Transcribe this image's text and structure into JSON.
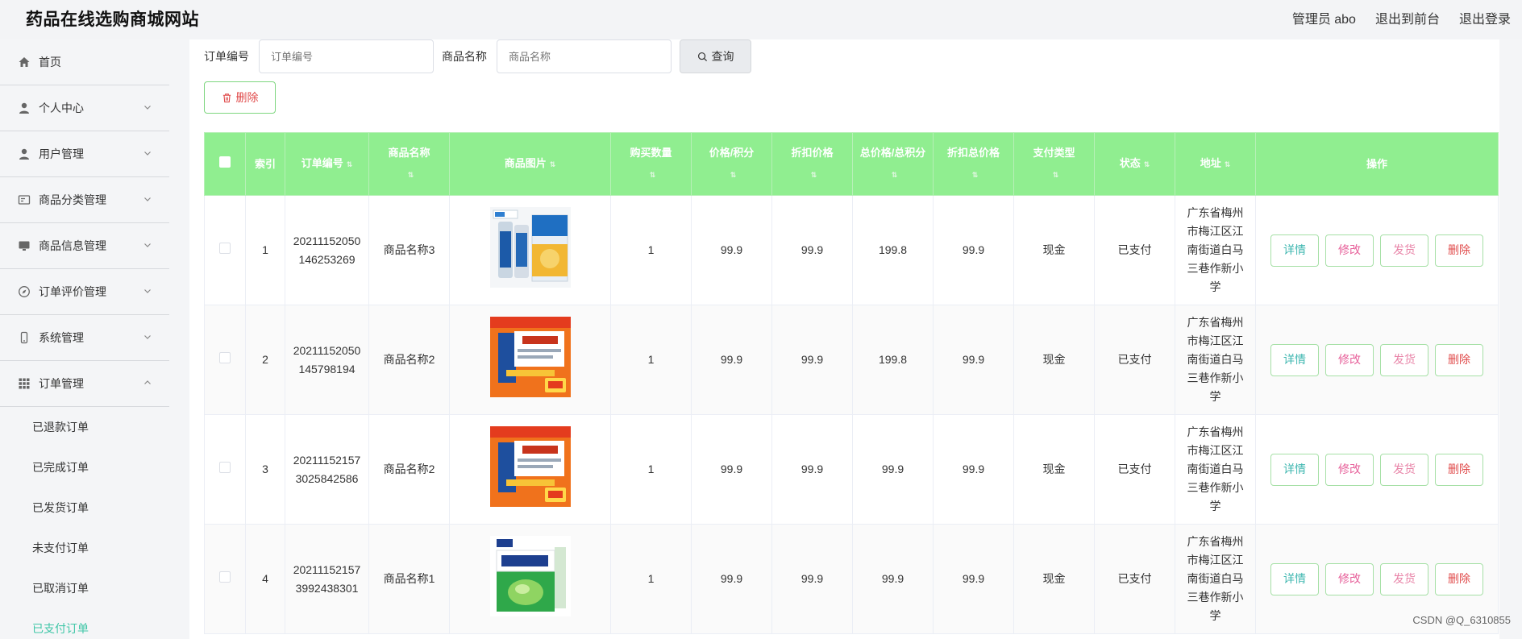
{
  "app": {
    "title": "药品在线选购商城网站",
    "user_label": "管理员 abo",
    "back_to_front": "退出到前台",
    "logout": "退出登录"
  },
  "sidebar": {
    "items": [
      {
        "label": "首页",
        "icon": "home-icon"
      },
      {
        "label": "个人中心",
        "icon": "user-icon"
      },
      {
        "label": "用户管理",
        "icon": "user-icon"
      },
      {
        "label": "商品分类管理",
        "icon": "category-icon"
      },
      {
        "label": "商品信息管理",
        "icon": "monitor-icon"
      },
      {
        "label": "订单评价管理",
        "icon": "compass-icon"
      },
      {
        "label": "系统管理",
        "icon": "phone-icon"
      },
      {
        "label": "订单管理",
        "icon": "grid-icon"
      }
    ],
    "sub_items": [
      {
        "label": "已退款订单"
      },
      {
        "label": "已完成订单"
      },
      {
        "label": "已发货订单"
      },
      {
        "label": "未支付订单"
      },
      {
        "label": "已取消订单"
      },
      {
        "label": "已支付订单"
      }
    ]
  },
  "filters": {
    "order_no_label": "订单编号",
    "order_no_placeholder": "订单编号",
    "product_name_label": "商品名称",
    "product_name_placeholder": "商品名称",
    "search_label": "查询"
  },
  "toolbar": {
    "delete_label": "删除"
  },
  "table": {
    "columns": [
      "索引",
      "订单编号",
      "商品名称",
      "商品图片",
      "购买数量",
      "价格/积分",
      "折扣价格",
      "总价格/总积分",
      "折扣总价格",
      "支付类型",
      "状态",
      "地址",
      "操作"
    ],
    "rows": [
      {
        "index": "1",
        "order_no": "20211152050146253269",
        "name": "商品名称3",
        "qty": "1",
        "price": "99.9",
        "discount_price": "99.9",
        "total": "199.8",
        "discount_total": "99.9",
        "pay_type": "现金",
        "status": "已支付",
        "address": "广东省梅州市梅江区江南街道白马三巷作新小学",
        "image": "blue-tubes"
      },
      {
        "index": "2",
        "order_no": "20211152050145798194",
        "name": "商品名称2",
        "qty": "1",
        "price": "99.9",
        "discount_price": "99.9",
        "total": "199.8",
        "discount_total": "99.9",
        "pay_type": "现金",
        "status": "已支付",
        "address": "广东省梅州市梅江区江南街道白马三巷作新小学",
        "image": "orange-box"
      },
      {
        "index": "3",
        "order_no": "202111521573025842586",
        "name": "商品名称2",
        "qty": "1",
        "price": "99.9",
        "discount_price": "99.9",
        "total": "99.9",
        "discount_total": "99.9",
        "pay_type": "现金",
        "status": "已支付",
        "address": "广东省梅州市梅江区江南街道白马三巷作新小学",
        "image": "orange-box"
      },
      {
        "index": "4",
        "order_no": "202111521573992438301",
        "name": "商品名称1",
        "qty": "1",
        "price": "99.9",
        "discount_price": "99.9",
        "total": "99.9",
        "discount_total": "99.9",
        "pay_type": "现金",
        "status": "已支付",
        "address": "广东省梅州市梅江区江南街道白马三巷作新小学",
        "image": "green-box"
      }
    ],
    "op_labels": {
      "detail": "详情",
      "edit": "修改",
      "ship": "发货",
      "delete": "删除"
    }
  },
  "watermark": "CSDN @Q_6310855",
  "colors": {
    "header_green": "#90ee90",
    "active_teal": "#3fc6a7",
    "delete_red": "#e04b4b"
  }
}
